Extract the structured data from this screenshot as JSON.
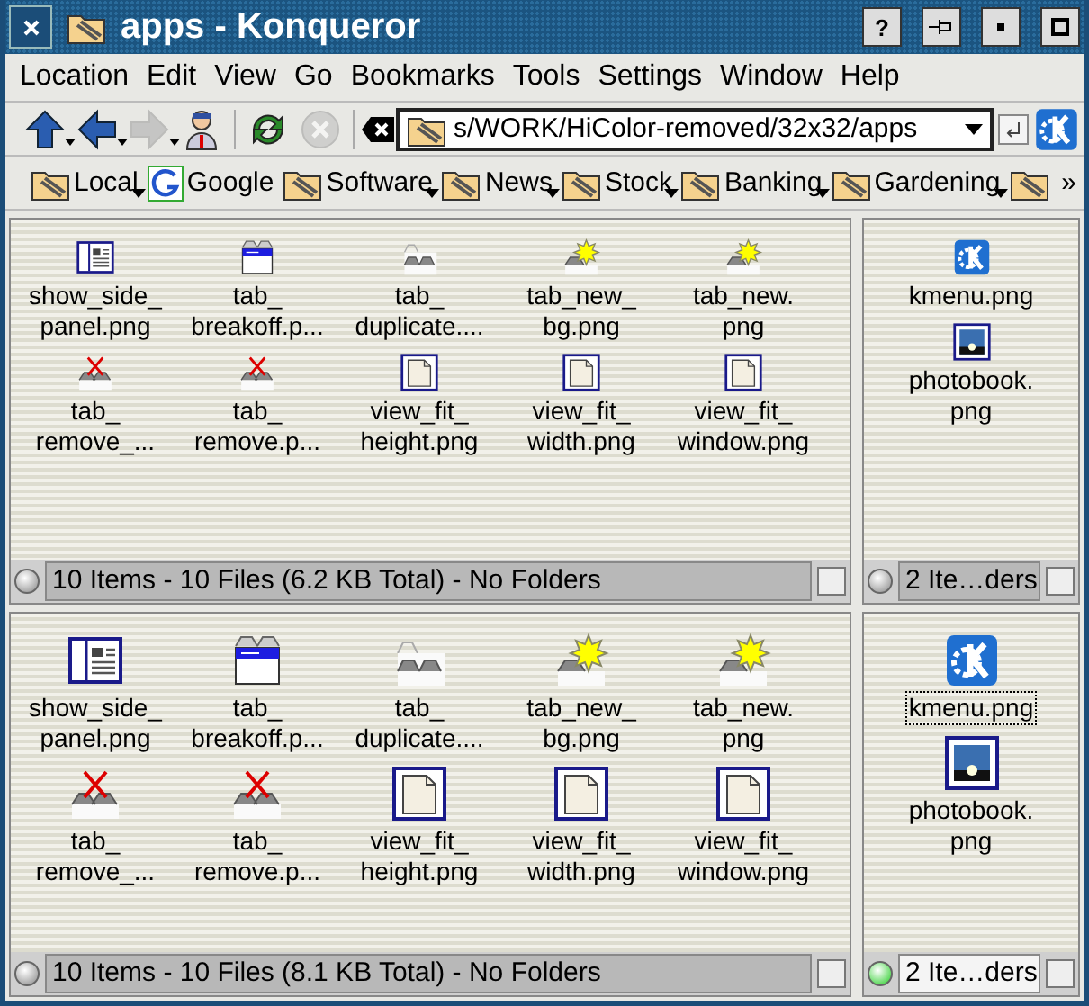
{
  "window": {
    "title": "apps - Konqueror",
    "buttons": [
      {
        "kind": "help",
        "label": "?"
      },
      {
        "kind": "pin"
      },
      {
        "kind": "minimize"
      },
      {
        "kind": "maximize"
      }
    ]
  },
  "menu": [
    "Location",
    "Edit",
    "View",
    "Go",
    "Bookmarks",
    "Tools",
    "Settings",
    "Window",
    "Help"
  ],
  "toolbar": [
    {
      "kind": "up",
      "menu": true,
      "disabled": false
    },
    {
      "kind": "back",
      "menu": true,
      "disabled": false
    },
    {
      "kind": "forward",
      "menu": true,
      "disabled": true
    },
    {
      "kind": "home",
      "menu": false,
      "disabled": false
    },
    {
      "kind": "reload",
      "menu": false,
      "disabled": false
    },
    {
      "kind": "stop",
      "menu": false,
      "disabled": true
    }
  ],
  "location": {
    "value": "s/WORK/HiColor-removed/32x32/apps"
  },
  "bookmarks": [
    {
      "label": "Local",
      "kind": "folder",
      "menu": true
    },
    {
      "label": "Google",
      "kind": "google",
      "menu": false
    },
    {
      "label": "Software",
      "kind": "folder",
      "menu": true
    },
    {
      "label": "News",
      "kind": "folder",
      "menu": true
    },
    {
      "label": "Stock",
      "kind": "folder",
      "menu": true
    },
    {
      "label": "Banking",
      "kind": "folder",
      "menu": true
    },
    {
      "label": "Gardening",
      "kind": "folder",
      "menu": true
    },
    {
      "kind": "folder",
      "menu": false
    }
  ],
  "bookmarks_more": "»",
  "views": [
    [
      {
        "kind": "small-icons",
        "active": false,
        "linked": false,
        "status": "10 Items - 10 Files (6.2 KB Total) - No Folders",
        "files": [
          {
            "kind": "panel",
            "lines": [
              "show_side_",
              "panel.png"
            ],
            "selected": false
          },
          {
            "kind": "breakoff",
            "lines": [
              "tab_",
              "breakoff.p..."
            ],
            "selected": false
          },
          {
            "kind": "duplicate",
            "lines": [
              "tab_",
              "duplicate...."
            ],
            "selected": false
          },
          {
            "kind": "new",
            "lines": [
              "tab_new_",
              "bg.png"
            ],
            "selected": false
          },
          {
            "kind": "new",
            "lines": [
              "tab_new.",
              "png"
            ],
            "selected": false
          },
          {
            "kind": "remove",
            "lines": [
              "tab_",
              "remove_..."
            ],
            "selected": false
          },
          {
            "kind": "remove",
            "lines": [
              "tab_",
              "remove.p..."
            ],
            "selected": false
          },
          {
            "kind": "page",
            "lines": [
              "view_fit_",
              "height.png"
            ],
            "selected": false
          },
          {
            "kind": "page",
            "lines": [
              "view_fit_",
              "width.png"
            ],
            "selected": false
          },
          {
            "kind": "page",
            "lines": [
              "view_fit_",
              "window.png"
            ],
            "selected": false
          }
        ]
      },
      {
        "kind": "small-icons",
        "active": false,
        "linked": false,
        "status": "2 Ite…ders",
        "files": [
          {
            "kind": "kde",
            "lines": [
              "kmenu.png"
            ],
            "selected": false
          },
          {
            "kind": "photo",
            "lines": [
              "photobook.",
              "png"
            ],
            "selected": false
          }
        ]
      }
    ],
    [
      {
        "kind": "large-icons",
        "active": false,
        "linked": false,
        "status": "10 Items - 10 Files (8.1 KB Total) - No Folders",
        "files": [
          {
            "kind": "panel",
            "lines": [
              "show_side_",
              "panel.png"
            ],
            "selected": false
          },
          {
            "kind": "breakoff",
            "lines": [
              "tab_",
              "breakoff.p..."
            ],
            "selected": false
          },
          {
            "kind": "duplicate",
            "lines": [
              "tab_",
              "duplicate...."
            ],
            "selected": false
          },
          {
            "kind": "new",
            "lines": [
              "tab_new_",
              "bg.png"
            ],
            "selected": false
          },
          {
            "kind": "new",
            "lines": [
              "tab_new.",
              "png"
            ],
            "selected": false
          },
          {
            "kind": "remove",
            "lines": [
              "tab_",
              "remove_..."
            ],
            "selected": false
          },
          {
            "kind": "remove",
            "lines": [
              "tab_",
              "remove.p..."
            ],
            "selected": false
          },
          {
            "kind": "page",
            "lines": [
              "view_fit_",
              "height.png"
            ],
            "selected": false
          },
          {
            "kind": "page",
            "lines": [
              "view_fit_",
              "width.png"
            ],
            "selected": false
          },
          {
            "kind": "page",
            "lines": [
              "view_fit_",
              "window.png"
            ],
            "selected": false
          }
        ]
      },
      {
        "kind": "large-icons",
        "active": true,
        "linked": false,
        "status": "2 Ite…ders",
        "files": [
          {
            "kind": "kde",
            "lines": [
              "kmenu.png"
            ],
            "selected": true
          },
          {
            "kind": "photo",
            "lines": [
              "photobook.",
              "png"
            ],
            "selected": false
          }
        ]
      }
    ]
  ]
}
